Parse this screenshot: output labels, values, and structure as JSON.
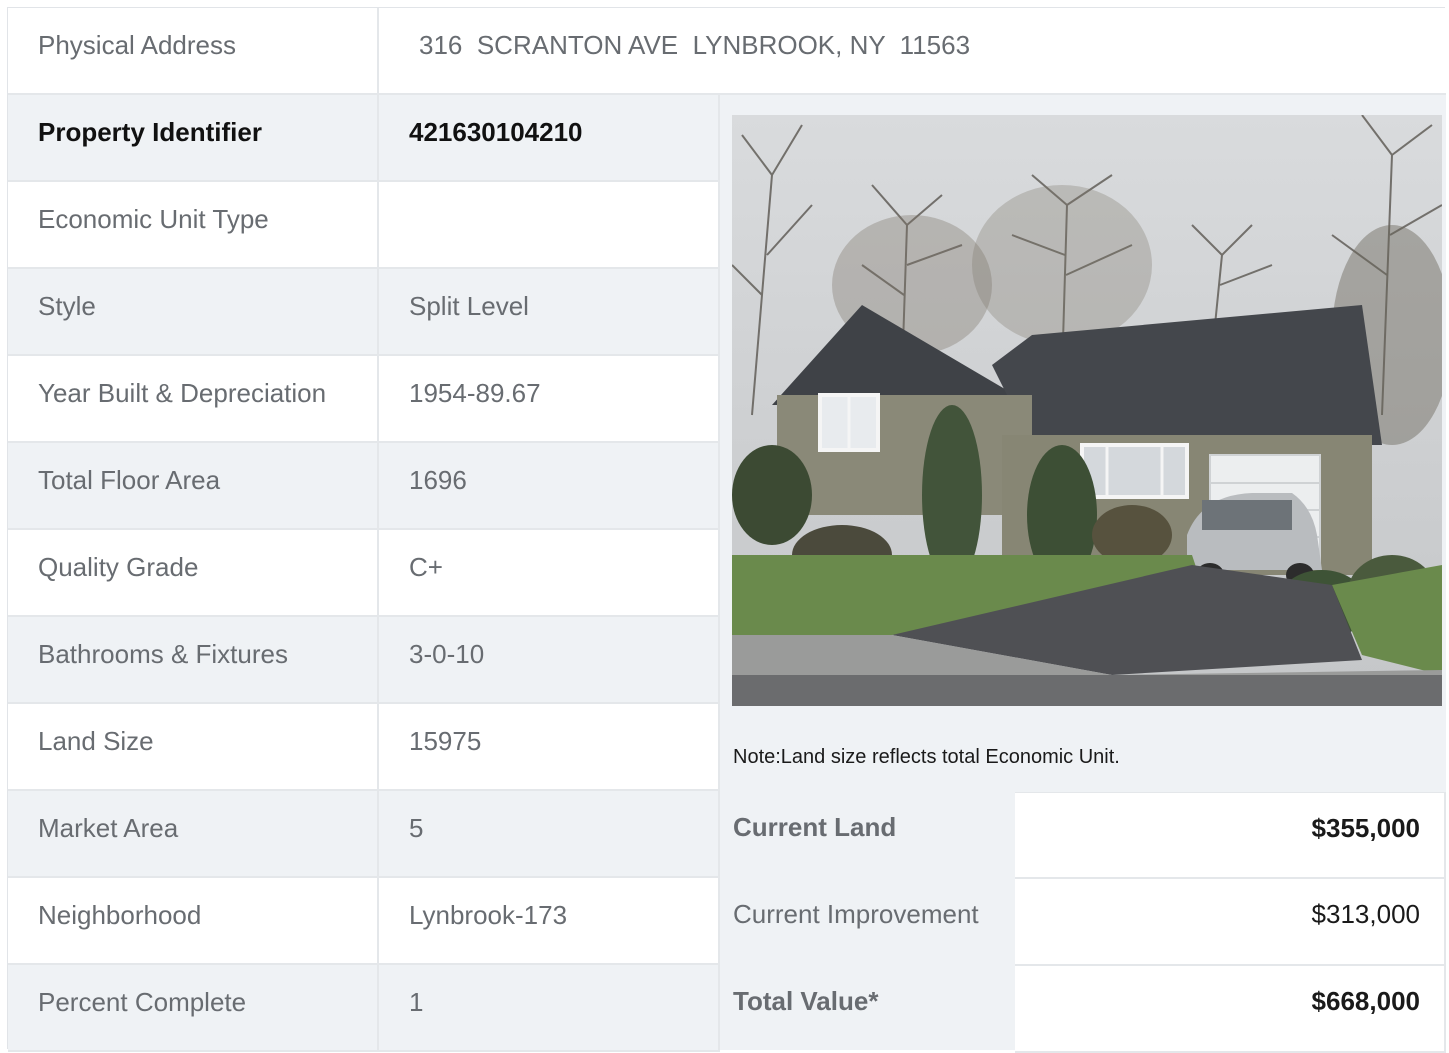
{
  "address": {
    "label": "Physical Address",
    "value": "316  SCRANTON AVE  LYNBROOK, NY  11563"
  },
  "details": [
    {
      "label": "Property Identifier",
      "value": "421630104210",
      "bold": true
    },
    {
      "label": "Economic Unit Type",
      "value": ""
    },
    {
      "label": "Style",
      "value": "Split Level"
    },
    {
      "label": "Year Built & Depreciation",
      "value": "1954-89.67"
    },
    {
      "label": "Total Floor Area",
      "value": "1696"
    },
    {
      "label": "Quality Grade",
      "value": "C+"
    },
    {
      "label": "Bathrooms & Fixtures",
      "value": "3-0-10"
    },
    {
      "label": "Land Size",
      "value": "15975"
    },
    {
      "label": "Market Area",
      "value": "5"
    },
    {
      "label": "Neighborhood",
      "value": "Lynbrook-173"
    },
    {
      "label": "Percent Complete",
      "value": "1"
    }
  ],
  "note": "Note:Land size reflects total Economic Unit.",
  "valuation": [
    {
      "label": "Current Land",
      "value": "$355,000",
      "bold": true
    },
    {
      "label": "Current Improvement",
      "value": "$313,000",
      "bold": false
    },
    {
      "label": "Total Value*",
      "value": "$668,000",
      "bold": true
    }
  ],
  "colors": {
    "row_shade": "#eff2f5",
    "border": "#e4e7ea",
    "label_text": "#686c71",
    "bold_text": "#111111"
  }
}
